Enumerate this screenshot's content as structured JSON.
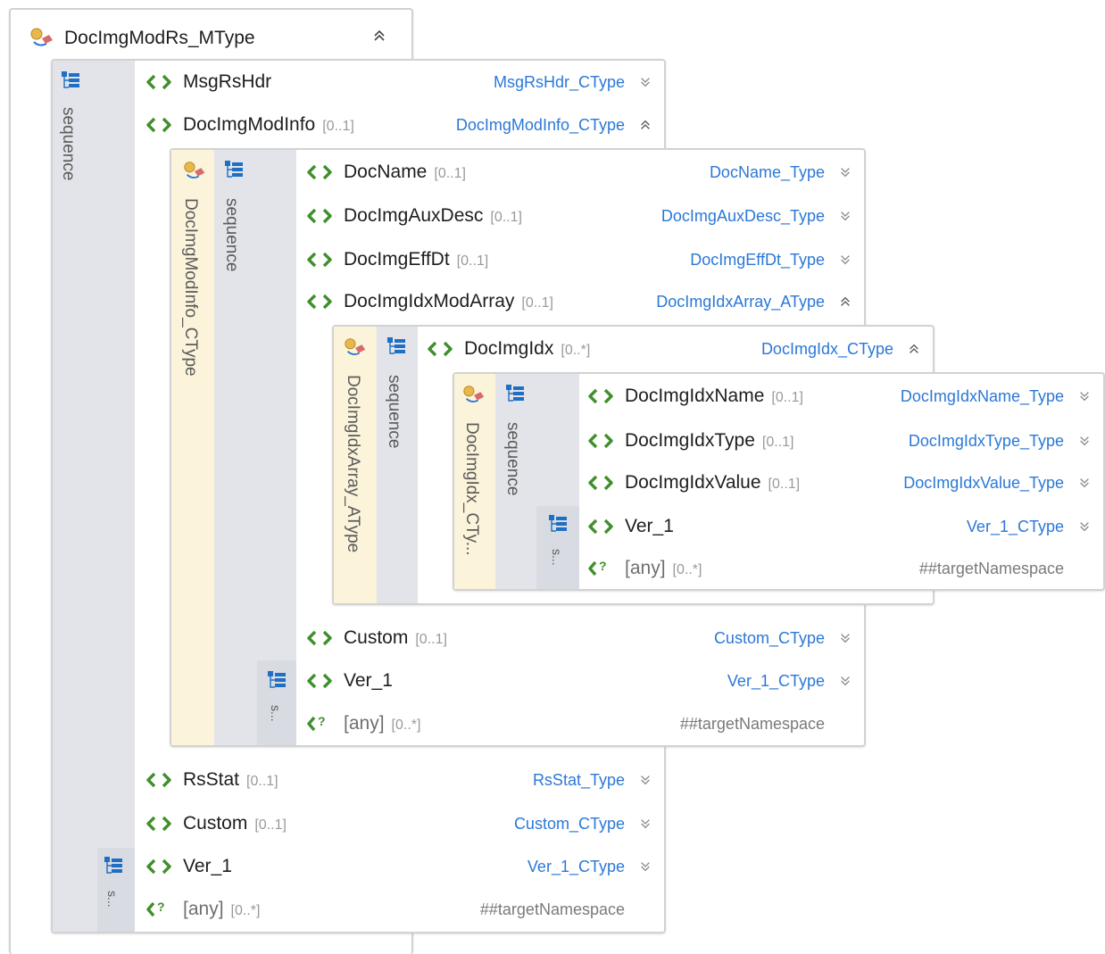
{
  "root": {
    "title": "DocImgModRs_MType",
    "seq_label": "sequence",
    "sub_seq_label": "s..."
  },
  "root_rows": [
    {
      "name": "MsgRsHdr",
      "card": "",
      "type": "MsgRsHdr_CType",
      "chev": "down"
    },
    {
      "name": "DocImgModInfo",
      "card": "[0..1]",
      "type": "DocImgModInfo_CType",
      "chev": "up"
    },
    {
      "name": "RsStat",
      "card": "[0..1]",
      "type": "RsStat_Type",
      "chev": "down"
    },
    {
      "name": "Custom",
      "card": "[0..1]",
      "type": "Custom_CType",
      "chev": "down"
    },
    {
      "name": "Ver_1",
      "card": "",
      "type": "Ver_1_CType",
      "chev": "down"
    },
    {
      "name": "[any]",
      "card": "[0..*]",
      "type": "##targetNamespace",
      "chev": "none",
      "any": true
    }
  ],
  "modinfo": {
    "type_label": "DocImgModInfo_CType",
    "seq_label": "sequence",
    "sub_seq_label": "s..."
  },
  "modinfo_rows": [
    {
      "name": "DocName",
      "card": "[0..1]",
      "type": "DocName_Type",
      "chev": "down"
    },
    {
      "name": "DocImgAuxDesc",
      "card": "[0..1]",
      "type": "DocImgAuxDesc_Type",
      "chev": "down"
    },
    {
      "name": "DocImgEffDt",
      "card": "[0..1]",
      "type": "DocImgEffDt_Type",
      "chev": "down"
    },
    {
      "name": "DocImgIdxModArray",
      "card": "[0..1]",
      "type": "DocImgIdxArray_AType",
      "chev": "up"
    },
    {
      "name": "Custom",
      "card": "[0..1]",
      "type": "Custom_CType",
      "chev": "down"
    },
    {
      "name": "Ver_1",
      "card": "",
      "type": "Ver_1_CType",
      "chev": "down"
    },
    {
      "name": "[any]",
      "card": "[0..*]",
      "type": "##targetNamespace",
      "chev": "none",
      "any": true
    }
  ],
  "idxarray": {
    "type_label": "DocImgIdxArray_AType",
    "seq_label": "sequence"
  },
  "idxarray_rows": [
    {
      "name": "DocImgIdx",
      "card": "[0..*]",
      "type": "DocImgIdx_CType",
      "chev": "up"
    }
  ],
  "idx": {
    "type_label": "DocImgIdx_CTy...",
    "seq_label": "sequence",
    "sub_seq_label": "s..."
  },
  "idx_rows": [
    {
      "name": "DocImgIdxName",
      "card": "[0..1]",
      "type": "DocImgIdxName_Type",
      "chev": "down"
    },
    {
      "name": "DocImgIdxType",
      "card": "[0..1]",
      "type": "DocImgIdxType_Type",
      "chev": "down"
    },
    {
      "name": "DocImgIdxValue",
      "card": "[0..1]",
      "type": "DocImgIdxValue_Type",
      "chev": "down"
    },
    {
      "name": "Ver_1",
      "card": "",
      "type": "Ver_1_CType",
      "chev": "down"
    },
    {
      "name": "[any]",
      "card": "[0..*]",
      "type": "##targetNamespace",
      "chev": "none",
      "any": true
    }
  ],
  "colors": {
    "type_link": "#2b78d6",
    "seq_bg": "#e2e4e9",
    "ctype_bg": "#fbf4da",
    "border": "#d2d2d2",
    "icon_green": "#3f8f2c",
    "icon_blue": "#1f6fc4"
  }
}
